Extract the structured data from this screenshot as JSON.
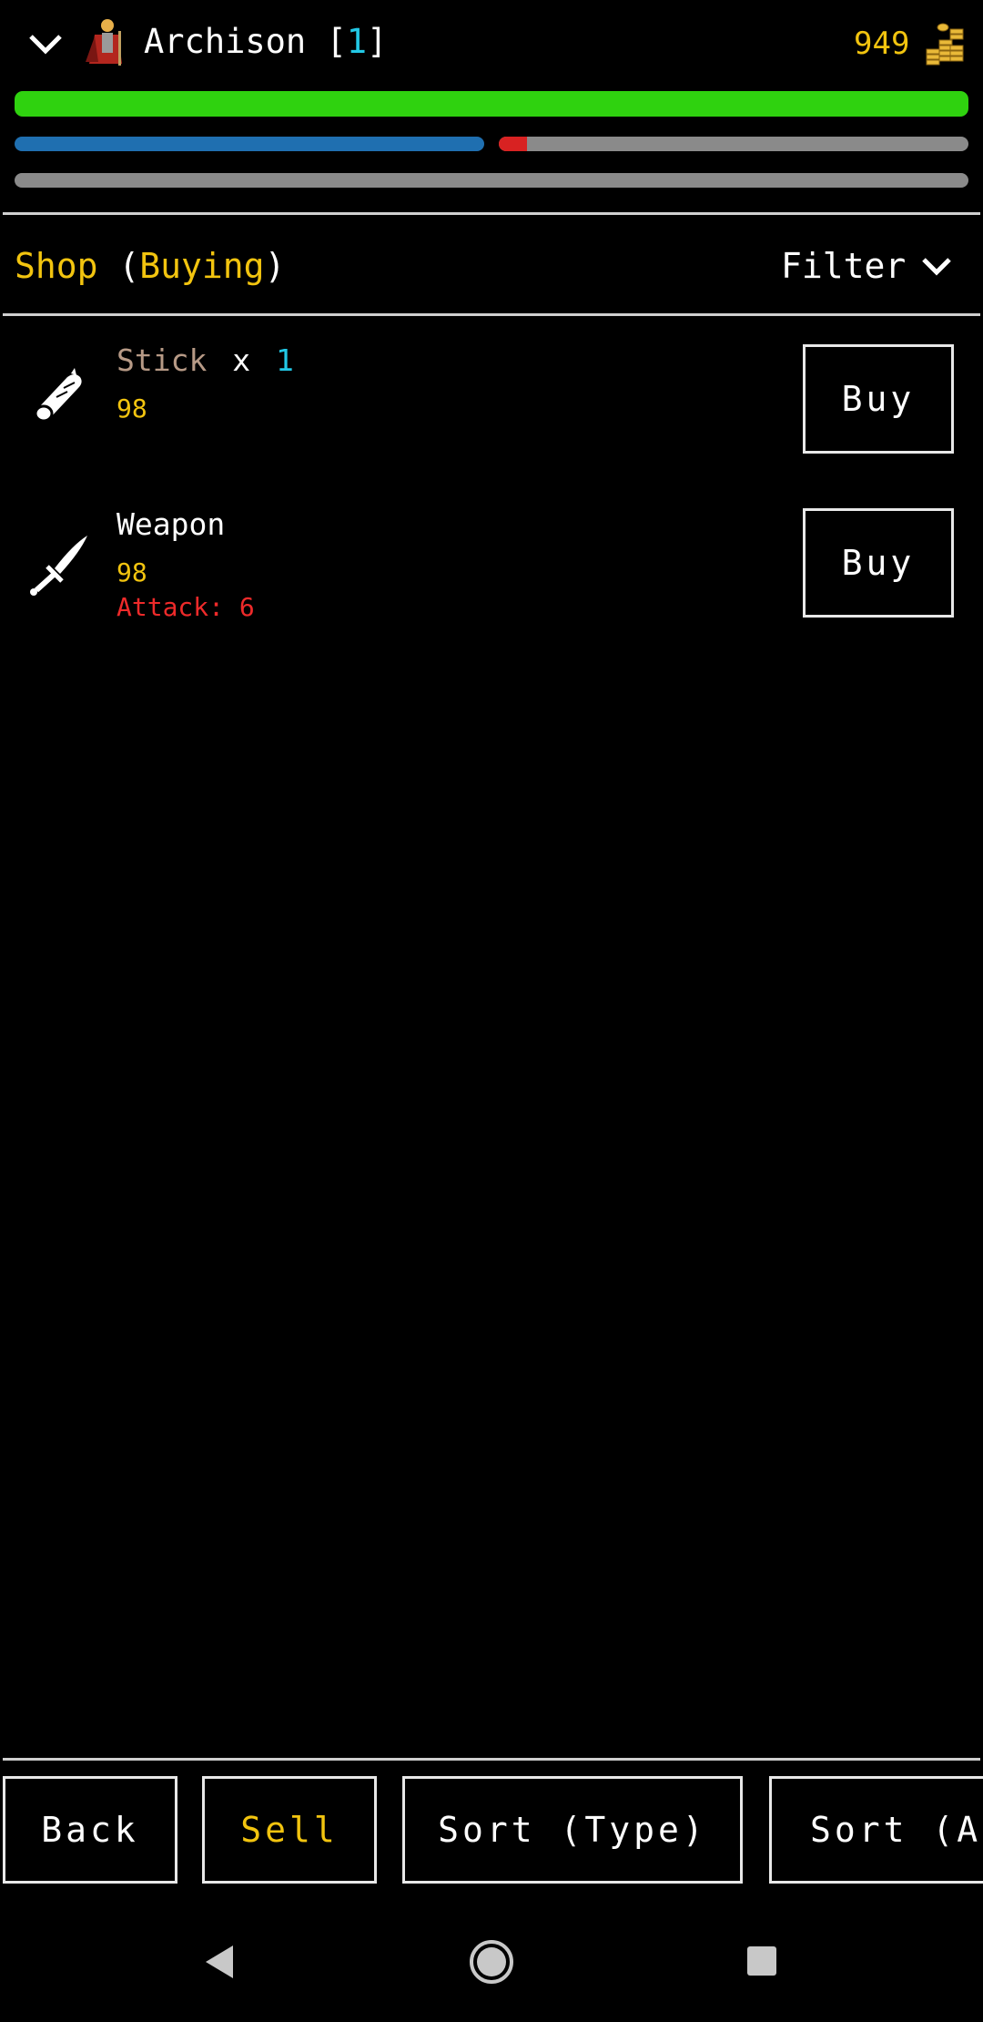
{
  "header": {
    "character_name": "Archison",
    "level_open": "[",
    "level": "1",
    "level_close": "]",
    "gold": "949",
    "icons": {
      "collapse": "chevron-down-icon",
      "avatar": "knight-avatar-icon",
      "gold": "gold-coins-icon"
    },
    "bars": {
      "health": 1.0,
      "mana": 1.0,
      "stamina": 0.06,
      "experience": 0.0
    }
  },
  "shop": {
    "title": "Shop",
    "mode_open": "(",
    "mode": "Buying",
    "mode_close": ")",
    "filter_label": "Filter"
  },
  "items": [
    {
      "name": "Stick",
      "quantity_prefix": "x",
      "quantity": "1",
      "price": "98",
      "buy_label": "Buy",
      "icon": "stick-icon"
    },
    {
      "name": "Weapon",
      "price": "98",
      "stat_label": "Attack",
      "stat_sep": ":",
      "stat_value": "6",
      "buy_label": "Buy",
      "icon": "dagger-icon"
    }
  ],
  "footer": {
    "back": "Back",
    "sell": "Sell",
    "sort_type": "Sort (Type)",
    "sort_partial": "Sort (A"
  },
  "colors": {
    "background": "#000000",
    "gold_text": "#f2c40f",
    "level_text": "#22c8e6",
    "health": "#2fd20f",
    "mana": "#1f6fb0",
    "stamina_fill": "#d82222",
    "empty_bar": "#8a8a8a",
    "attack_text": "#ee2a2a",
    "stick_name": "#b79a86"
  }
}
